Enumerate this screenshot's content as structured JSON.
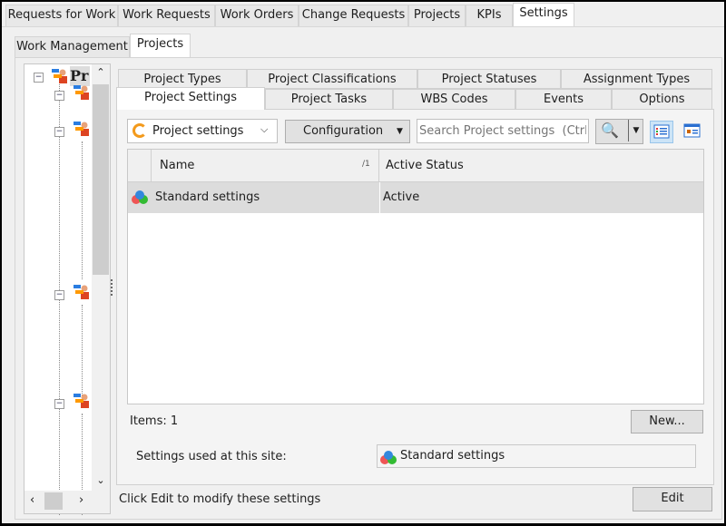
{
  "top_tabs": [
    "Requests for Work",
    "Work Requests",
    "Work Orders",
    "Change Requests",
    "Projects",
    "KPIs",
    "Settings"
  ],
  "top_tab_selected": "Settings",
  "sub_tabs": [
    "Work Management",
    "Projects"
  ],
  "sub_tab_selected": "Projects",
  "tree": {
    "root_label": "Pr"
  },
  "inner_tabs_row1": [
    "Project Types",
    "Project Classifications",
    "Project Statuses",
    "Assignment Types"
  ],
  "inner_tabs_row2": [
    "Project Settings",
    "Project Tasks",
    "WBS Codes",
    "Events",
    "Options"
  ],
  "inner_tab_selected": "Project Settings",
  "toolbar": {
    "view_select": "Project settings",
    "configuration": "Configuration",
    "search_placeholder": "Search Project settings  (Ctrl+F)"
  },
  "grid": {
    "columns": [
      "Name",
      "Active Status"
    ],
    "sort_indicator": "1",
    "rows": [
      {
        "name": "Standard settings",
        "status": "Active"
      }
    ]
  },
  "items_count": "Items: 1",
  "new_button": "New...",
  "site_settings_label": "Settings used at this site:",
  "site_settings_value": "Standard settings",
  "hint": "Click Edit to modify these settings",
  "edit_button": "Edit"
}
